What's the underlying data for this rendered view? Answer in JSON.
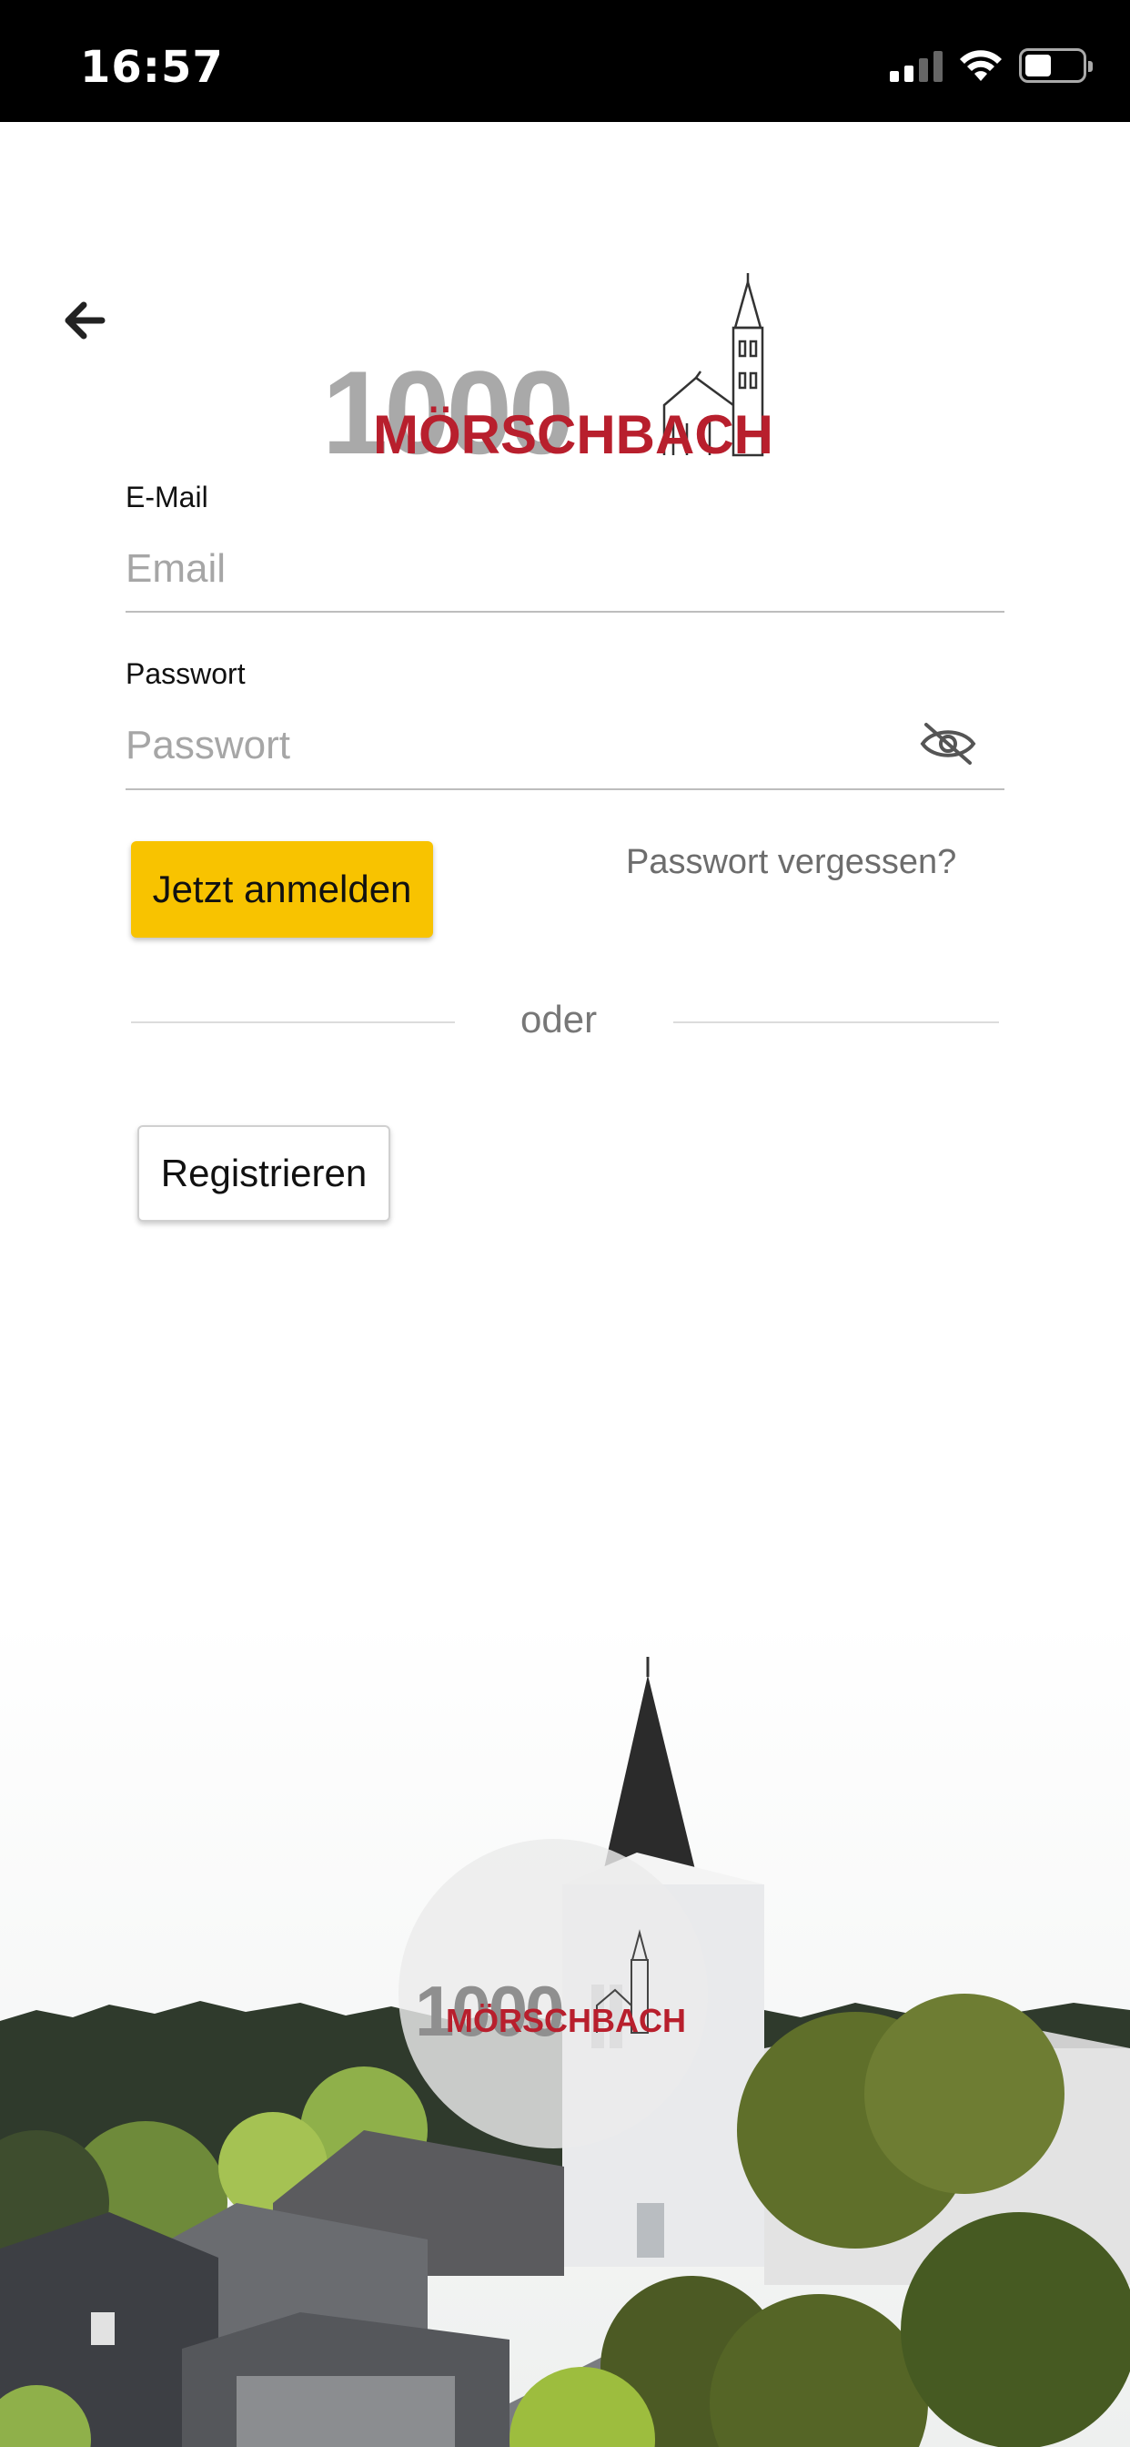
{
  "status_bar": {
    "time": "16:57",
    "icons": [
      "signal-icon",
      "wifi-icon",
      "battery-icon"
    ]
  },
  "header": {
    "back_icon": "arrow-left-icon",
    "logo": {
      "number": "1000",
      "name": "MÖRSCHBACH"
    }
  },
  "form": {
    "email_label": "E-Mail",
    "email_placeholder": "Email",
    "email_value": "",
    "password_label": "Passwort",
    "password_placeholder": "Passwort",
    "password_value": "",
    "visibility_icon": "eye-off-icon",
    "login_button": "Jetzt anmelden",
    "forgot_link": "Passwort vergessen?",
    "divider_text": "oder",
    "register_button": "Registrieren"
  },
  "footer": {
    "watermark_number": "1000",
    "watermark_name": "MÖRSCHBACH"
  },
  "colors": {
    "accent": "#f8c300",
    "brand_red": "#b81f2d",
    "logo_gray": "#a9a9a9",
    "placeholder": "#a6a6a6"
  }
}
